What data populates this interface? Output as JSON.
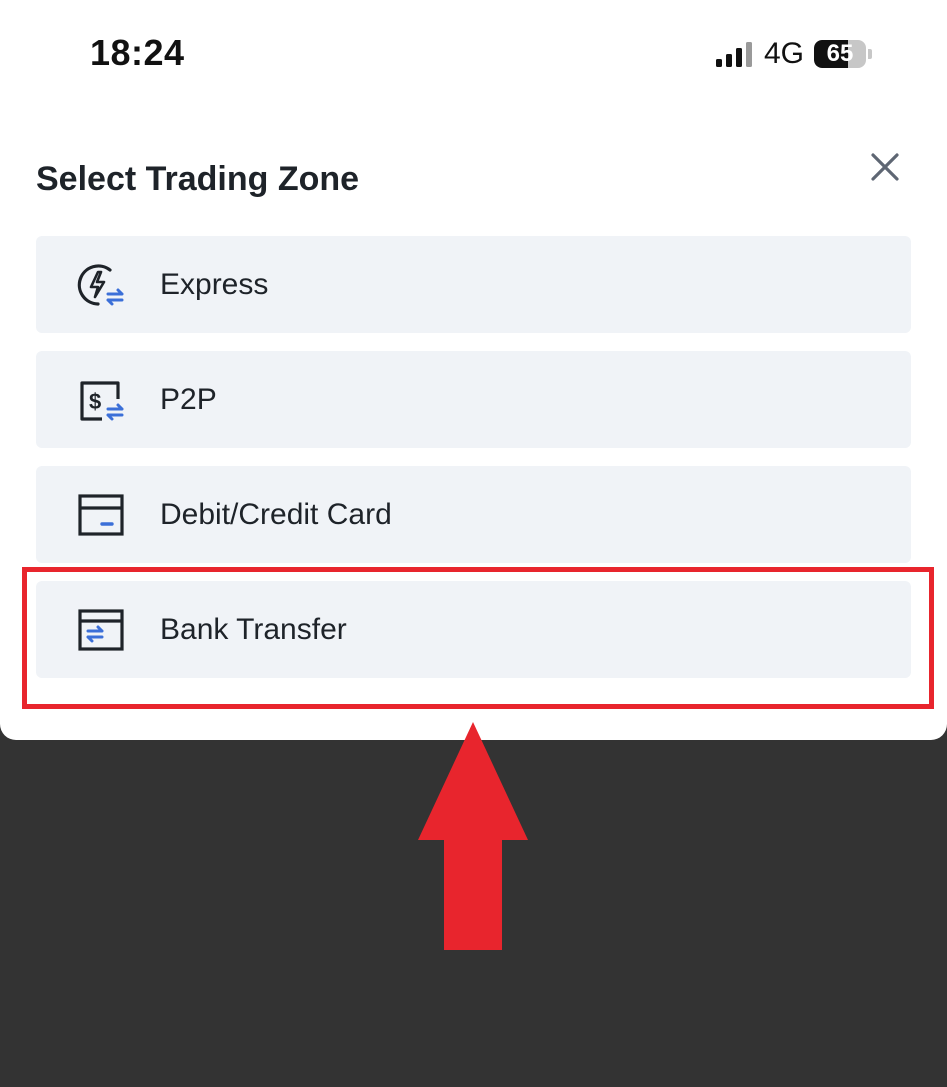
{
  "status_bar": {
    "time": "18:24",
    "network": "4G",
    "battery": "65",
    "battery_level": 0.65
  },
  "sheet": {
    "title": "Select Trading Zone",
    "close_icon": "close-icon"
  },
  "options": [
    {
      "label": "Express",
      "icon": "lightning-exchange-icon"
    },
    {
      "label": "P2P",
      "icon": "dollar-exchange-icon"
    },
    {
      "label": "Debit/Credit Card",
      "icon": "card-icon"
    },
    {
      "label": "Bank Transfer",
      "icon": "bank-transfer-icon"
    }
  ],
  "colors": {
    "accent_blue": "#3b6fd8",
    "icon_dark": "#1e2329",
    "option_bg": "#f0f3f7",
    "annotation_red": "#e8252d",
    "backdrop": "#333333"
  }
}
